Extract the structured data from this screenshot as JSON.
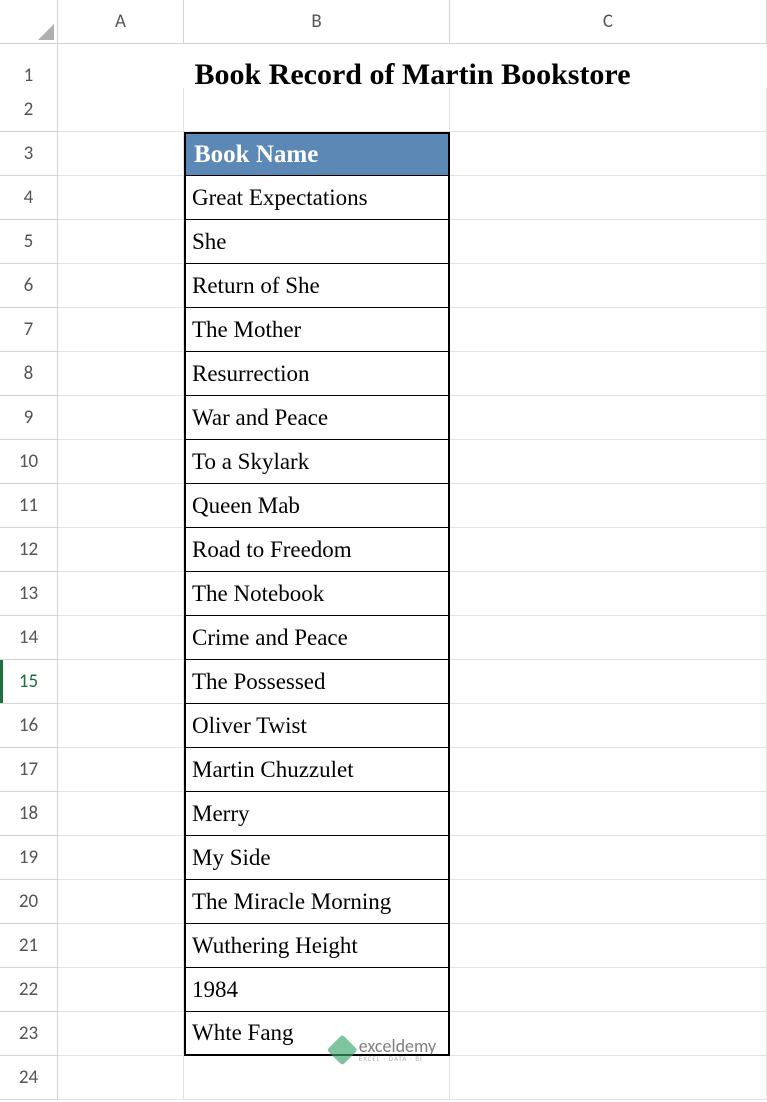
{
  "columns": [
    "A",
    "B",
    "C"
  ],
  "row_numbers": [
    "1",
    "2",
    "3",
    "4",
    "5",
    "6",
    "7",
    "8",
    "9",
    "10",
    "11",
    "12",
    "13",
    "14",
    "15",
    "16",
    "17",
    "18",
    "19",
    "20",
    "21",
    "22",
    "23",
    "24"
  ],
  "selected_row": 15,
  "title": "Book Record of Martin Bookstore",
  "table": {
    "header": "Book Name",
    "rows": [
      "Great Expectations",
      "She",
      "Return of She",
      "The Mother",
      "Resurrection",
      "War and Peace",
      "To a Skylark",
      "Queen Mab",
      "Road to Freedom",
      "The Notebook",
      "Crime and Peace",
      "The Possessed",
      "Oliver Twist",
      "Martin Chuzzulet",
      "Merry",
      "My Side",
      "The Miracle Morning",
      "Wuthering Height",
      "1984",
      "Whte Fang"
    ]
  },
  "watermark": {
    "brand": "exceldemy",
    "tagline": "EXCEL · DATA · BI"
  },
  "chart_data": {
    "type": "table",
    "title": "Book Record of Martin Bookstore",
    "columns": [
      "Book Name"
    ],
    "rows": [
      [
        "Great Expectations"
      ],
      [
        "She"
      ],
      [
        "Return of She"
      ],
      [
        "The Mother"
      ],
      [
        "Resurrection"
      ],
      [
        "War and Peace"
      ],
      [
        "To a Skylark"
      ],
      [
        "Queen Mab"
      ],
      [
        "Road to Freedom"
      ],
      [
        "The Notebook"
      ],
      [
        "Crime and Peace"
      ],
      [
        "The Possessed"
      ],
      [
        "Oliver Twist"
      ],
      [
        "Martin Chuzzulet"
      ],
      [
        "Merry"
      ],
      [
        "My Side"
      ],
      [
        "The Miracle Morning"
      ],
      [
        "Wuthering Height"
      ],
      [
        "1984"
      ],
      [
        "Whte Fang"
      ]
    ]
  }
}
